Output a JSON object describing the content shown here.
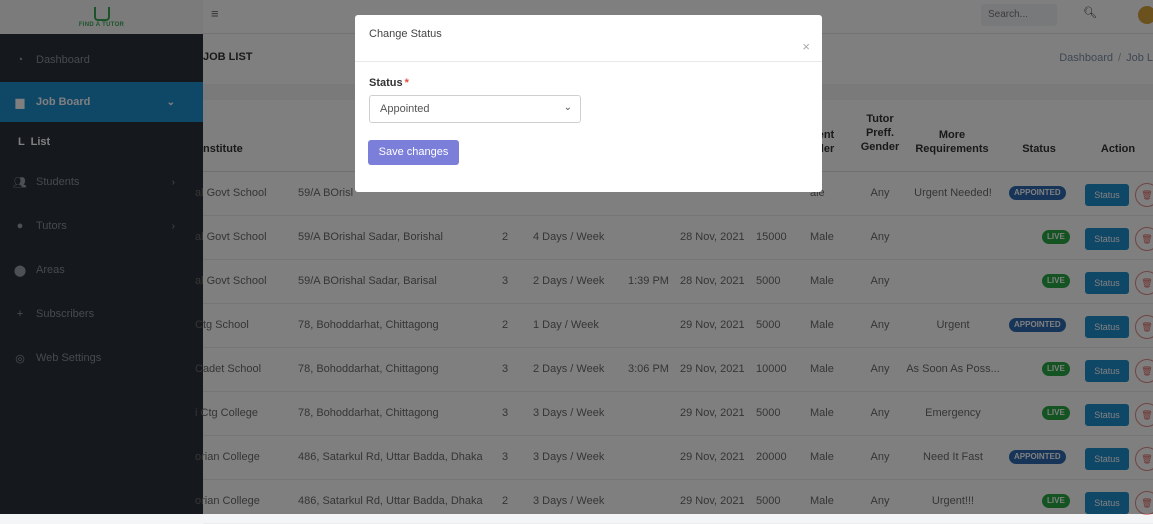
{
  "logo": {
    "text": "FIND A TUTOR"
  },
  "sidebar": {
    "items": [
      {
        "label": "Dashboard",
        "icon": "dashboard-icon"
      },
      {
        "label": "Job Board",
        "icon": "briefcase-icon"
      },
      {
        "label": "L  List",
        "icon": ""
      },
      {
        "label": "Students",
        "icon": "users-icon"
      },
      {
        "label": "Tutors",
        "icon": "user-icon"
      },
      {
        "label": "Areas",
        "icon": "map-marker-icon"
      },
      {
        "label": "Subscribers",
        "icon": "user-plus-icon"
      },
      {
        "label": "Web Settings",
        "icon": "globe-icon"
      }
    ]
  },
  "topbar": {
    "search_placeholder": "Search..."
  },
  "page": {
    "title": "JOB LIST",
    "crumb_home": "Dashboard",
    "crumb_current": "Job L"
  },
  "table": {
    "headers": {
      "institute": "nstitute",
      "student_gender": "dent\nder",
      "tutor_gender": "Tutor\nPreff.\nGender",
      "more": "More\nRequirements",
      "status": "Status",
      "action": "Action"
    },
    "rows": [
      {
        "institute": "al Govt School",
        "address": "59/A BOrisl",
        "subjects": "",
        "days": "",
        "time": "",
        "date": "",
        "salary": "",
        "sgender": "ale",
        "tgender": "Any",
        "req": "Urgent Needed!",
        "status": "APPOINTED"
      },
      {
        "institute": "al Govt School",
        "address": "59/A BOrishal Sadar, Borishal",
        "subjects": "2",
        "days": "4 Days / Week",
        "time": "",
        "date": "28 Nov, 2021",
        "salary": "15000",
        "sgender": "Male",
        "tgender": "Any",
        "req": "",
        "status": "LIVE"
      },
      {
        "institute": "al Govt School",
        "address": "59/A BOrishal Sadar, Barisal",
        "subjects": "3",
        "days": "2 Days / Week",
        "time": "1:39 PM",
        "date": "28 Nov, 2021",
        "salary": "5000",
        "sgender": "Male",
        "tgender": "Any",
        "req": "",
        "status": "LIVE"
      },
      {
        "institute": "Ctg School",
        "address": "78, Bohoddarhat, Chittagong",
        "subjects": "2",
        "days": "1 Day / Week",
        "time": "",
        "date": "29 Nov, 2021",
        "salary": "5000",
        "sgender": "Male",
        "tgender": "Any",
        "req": "Urgent",
        "status": "APPOINTED"
      },
      {
        "institute": "Cadet School",
        "address": "78, Bohoddarhat, Chittagong",
        "subjects": "3",
        "days": "2 Days / Week",
        "time": "3:06 PM",
        "date": "29 Nov, 2021",
        "salary": "10000",
        "sgender": "Male",
        "tgender": "Any",
        "req": "As Soon As Poss...",
        "status": "LIVE"
      },
      {
        "institute": "i Ctg College",
        "address": "78, Bohoddarhat, Chittagong",
        "subjects": "3",
        "days": "3 Days / Week",
        "time": "",
        "date": "29 Nov, 2021",
        "salary": "5000",
        "sgender": "Male",
        "tgender": "Any",
        "req": "Emergency",
        "status": "LIVE"
      },
      {
        "institute": "orian College",
        "address": "486, Satarkul Rd, Uttar Badda, Dhaka",
        "subjects": "3",
        "days": "3 Days / Week",
        "time": "",
        "date": "29 Nov, 2021",
        "salary": "20000",
        "sgender": "Male",
        "tgender": "Any",
        "req": "Need It Fast",
        "status": "APPOINTED"
      },
      {
        "institute": "orian College",
        "address": "486, Satarkul Rd, Uttar Badda, Dhaka",
        "subjects": "2",
        "days": "3 Days / Week",
        "time": "",
        "date": "29 Nov, 2021",
        "salary": "5000",
        "sgender": "Male",
        "tgender": "Any",
        "req": "Urgent!!!",
        "status": "LIVE"
      }
    ],
    "status_button": "Status"
  },
  "modal": {
    "title": "Change Status",
    "field_label": "Status",
    "required_mark": "*",
    "selected": "Appointed",
    "save_label": "Save changes",
    "close_glyph": "×"
  },
  "colors": {
    "sidebar": "#2b3138",
    "active": "#1f8fcf",
    "appointed": "#2d6ab3",
    "live": "#28a745",
    "save": "#7c7fd9"
  }
}
